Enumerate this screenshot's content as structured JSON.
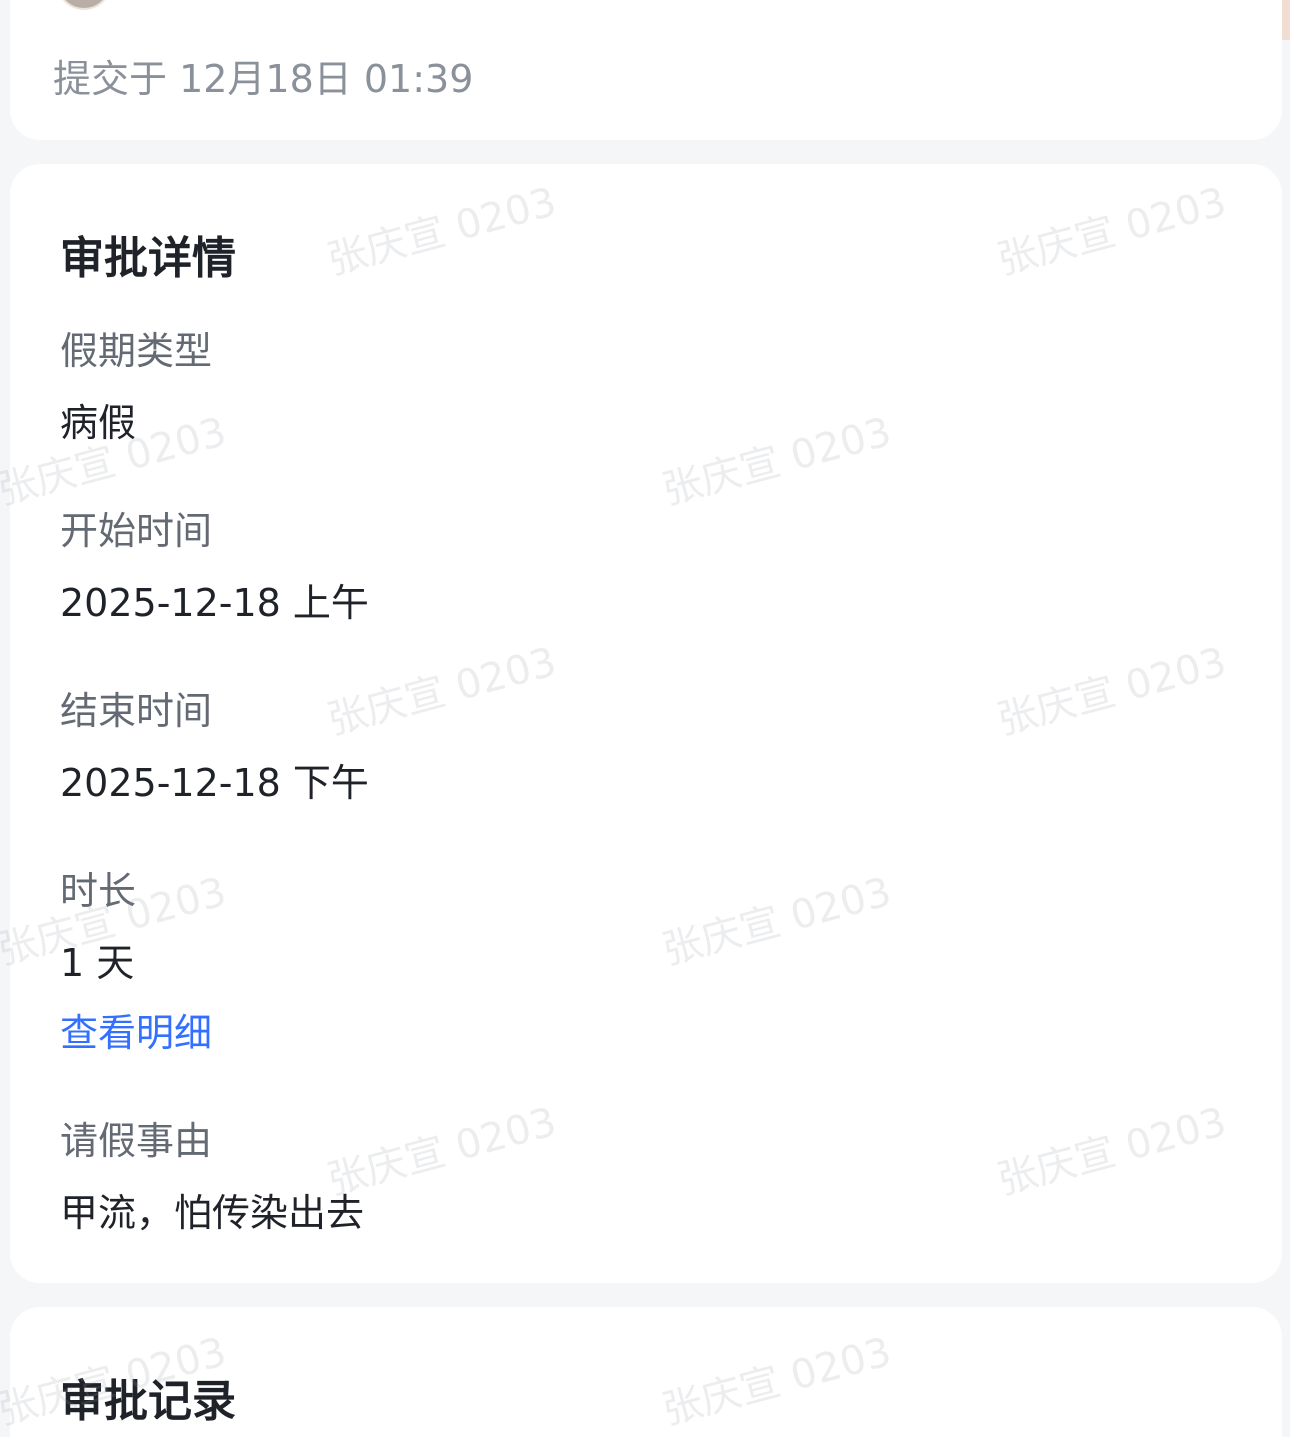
{
  "submission": {
    "submitted_text": "提交于 12月18日 01:39"
  },
  "details": {
    "title": "审批详情",
    "leave_type_label": "假期类型",
    "leave_type_value": "病假",
    "start_time_label": "开始时间",
    "start_time_value": "2025-12-18 上午",
    "end_time_label": "结束时间",
    "end_time_value": "2025-12-18 下午",
    "duration_label": "时长",
    "duration_value": "1 天",
    "view_details_link": "查看明细",
    "reason_label": "请假事由",
    "reason_value": "甲流，怕传染出去"
  },
  "records": {
    "title": "审批记录"
  },
  "watermark": {
    "text": "张庆宣 0203"
  }
}
